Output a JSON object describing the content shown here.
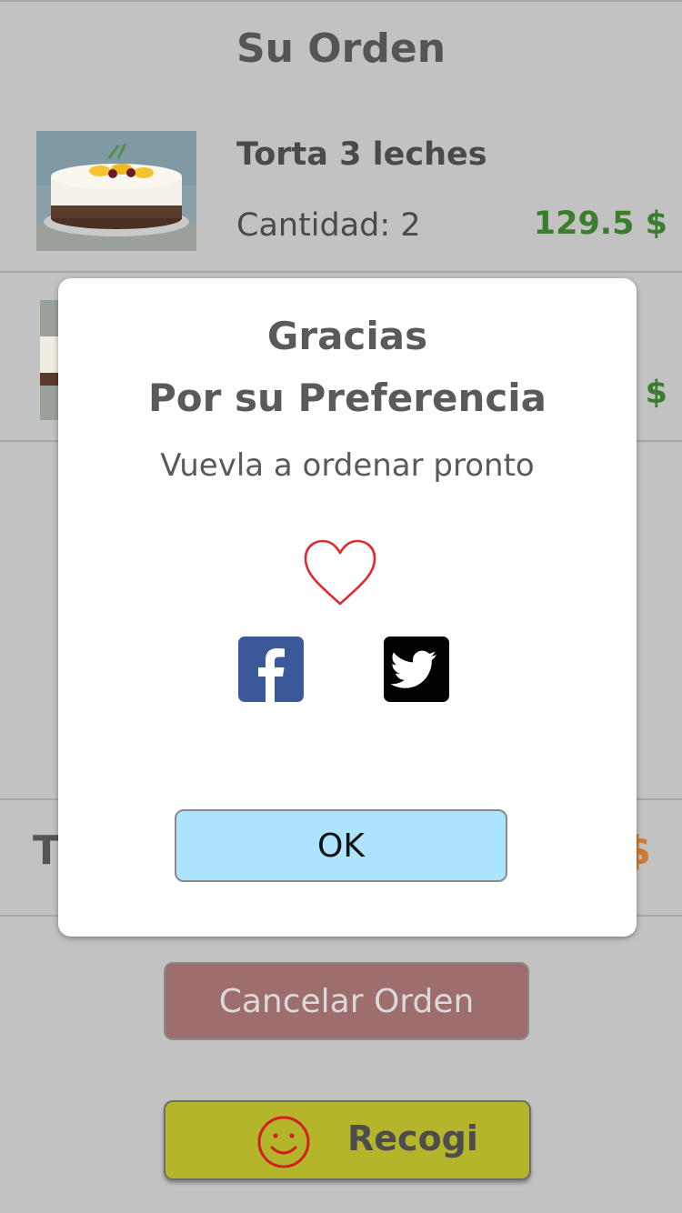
{
  "header": {
    "title": "Su Orden"
  },
  "order": {
    "items": [
      {
        "name": "Torta 3 leches",
        "quantity_label": "Cantidad: 2",
        "price": "129.5 $"
      },
      {
        "name": "",
        "quantity_label": "",
        "price": "$"
      }
    ],
    "total": {
      "label": "T",
      "value": "$"
    }
  },
  "actions": {
    "cancel_label": "Cancelar Orden",
    "pickup_label": "Recogi",
    "pickup_icon": "smiley-icon"
  },
  "modal": {
    "title_line1": "Gracias",
    "title_line2": "Por su Preferencia",
    "subtitle": "Vuevla a ordenar pronto",
    "heart_icon": "heart-icon",
    "facebook_icon": "facebook-icon",
    "twitter_icon": "twitter-icon",
    "ok_label": "OK"
  },
  "colors": {
    "background": "#c2c2c2",
    "price_green": "#3a7d2c",
    "total_orange": "#d07a33",
    "ok_blue": "#abe4fc",
    "cancel_red": "#9e6e6e",
    "pickup_olive": "#b4b52a",
    "heart_red": "#e0282e",
    "facebook_blue": "#3b5998"
  }
}
